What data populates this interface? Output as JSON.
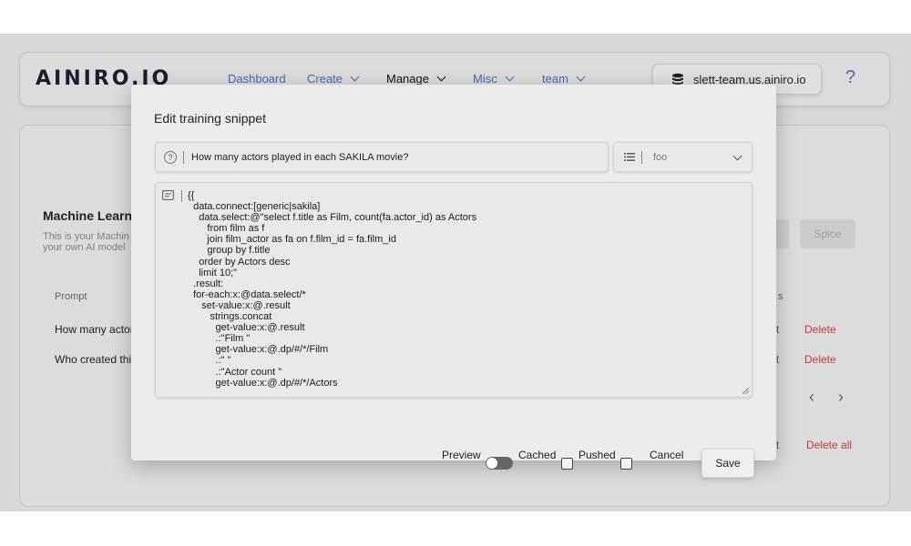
{
  "header": {
    "logo": "AINIRO.IO",
    "nav": [
      {
        "label": "Dashboard"
      },
      {
        "label": "Create"
      },
      {
        "label": "Manage"
      },
      {
        "label": "Misc"
      },
      {
        "label": "team"
      }
    ],
    "server": "slett-team.us.ainiro.io",
    "help": "?",
    "colors": {
      "nav_link": "#4a73b8",
      "nav_active": "#111111"
    }
  },
  "background_card": {
    "title": "Machine Learni",
    "description": "This is your Machin your own AI model",
    "columns": {
      "prompt": "Prompt",
      "s": "s"
    },
    "rows": [
      {
        "prompt": "How many actor",
        "t": "t",
        "action": "Delete"
      },
      {
        "prompt": "Who created thi",
        "t": "t",
        "action": "Delete"
      }
    ],
    "spice_button": "Spice",
    "pagination": {
      "prev": "‹",
      "next": "›"
    },
    "bottom_t": "t",
    "delete_all": "Delete all"
  },
  "modal": {
    "title": "Edit training snippet",
    "prompt_value": "How many actors played in each SAKILA movie?",
    "type_value": "foo",
    "code_lines": [
      "{{",
      "  data.connect:[generic|sakila]",
      "    data.select:@\"select f.title as Film, count(fa.actor_id) as Actors",
      "       from film as f",
      "       join film_actor as fa on f.film_id = fa.film_id",
      "       group by f.title",
      "    order by Actors desc",
      "    limit 10;\"",
      "  .result:",
      "  for-each:x:@data.select/*",
      "     set-value:x:@.result",
      "        strings.concat",
      "          get-value:x:@.result",
      "          .:\"Film \"",
      "          get-value:x:@.dp/#/*/Film",
      "          .:\" \"",
      "          .:\"Actor count \"",
      "          get-value:x:@.dp/#/*/Actors"
    ],
    "footer": {
      "preview_label": "Preview",
      "preview_on": false,
      "cached_label": "Cached",
      "cached_checked": false,
      "pushed_label": "Pushed",
      "pushed_checked": false,
      "cancel": "Cancel",
      "save": "Save"
    }
  },
  "colors": {
    "danger": "#d43c3c",
    "backdrop": "#e6e6e6",
    "modal_bg": "#ececec"
  }
}
